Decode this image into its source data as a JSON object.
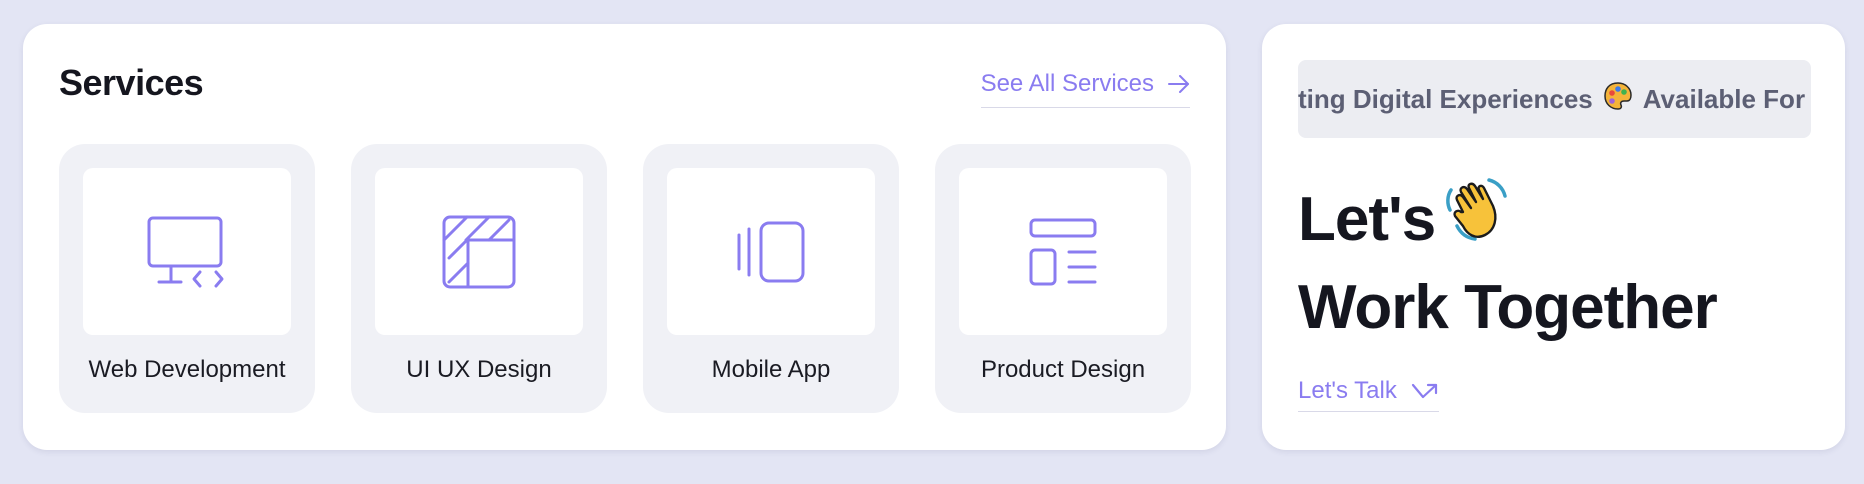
{
  "services": {
    "title": "Services",
    "see_all_label": "See All Services",
    "tiles": [
      {
        "label": "Web Development",
        "icon": "monitor-code-icon"
      },
      {
        "label": "UI UX Design",
        "icon": "design-grid-icon"
      },
      {
        "label": "Mobile App",
        "icon": "mobile-app-icon"
      },
      {
        "label": "Product Design",
        "icon": "layout-icon"
      }
    ]
  },
  "contact": {
    "marquee_text_1": "ting Digital Experiences",
    "marquee_text_2": "Available For H",
    "marquee_emoji": "palette-emoji",
    "heading_line1": "Let's",
    "heading_line2": "Work Together",
    "heading_emoji": "waving-hand-emoji",
    "talk_label": "Let's Talk"
  },
  "colors": {
    "background": "#e3e5f4",
    "card": "#ffffff",
    "tile": "#f0f1f6",
    "accent": "#8a7cf0",
    "heading": "#15161f",
    "marquee_text": "#5c5f74"
  }
}
